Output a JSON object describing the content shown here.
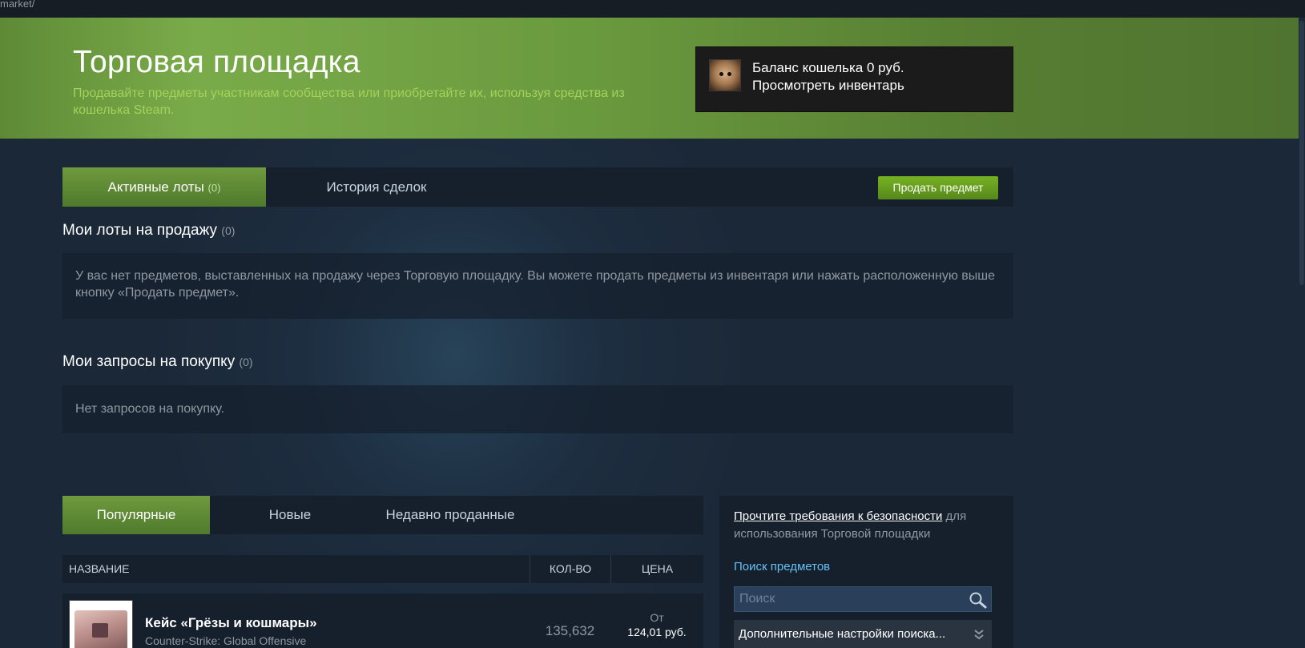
{
  "browser": {
    "url_fragment": "market/"
  },
  "hero": {
    "title": "Торговая площадка",
    "subtitle": "Продавайте предметы участникам сообщества или приобретайте их, используя средства из кошелька Steam."
  },
  "wallet": {
    "balance": "Баланс кошелька 0 руб.",
    "inventory_link": "Просмотреть инвентарь",
    "avatar_icon": "hamster-avatar"
  },
  "tabs": {
    "active_listings": "Активные лоты",
    "active_listings_count": "(0)",
    "history": "История сделок",
    "sell_button": "Продать предмет"
  },
  "my_listings": {
    "title": "Мои лоты на продажу",
    "count": "(0)",
    "empty_text": "У вас нет предметов, выставленных на продажу через Торговую площадку. Вы можете продать предметы из инвентаря или нажать расположенную выше кнопку «Продать предмет»."
  },
  "my_orders": {
    "title": "Мои запросы на покупку",
    "count": "(0)",
    "empty_text": "Нет запросов на покупку."
  },
  "browse_tabs": {
    "popular": "Популярные",
    "new": "Новые",
    "recently_sold": "Недавно проданные"
  },
  "table": {
    "headers": {
      "name": "НАЗВАНИЕ",
      "qty": "КОЛ-ВО",
      "price": "ЦЕНА"
    },
    "rows": [
      {
        "name": "Кейс «Грёзы и кошмары»",
        "game": "Counter-Strike: Global Offensive",
        "qty": "135,632",
        "price_from": "От",
        "price": "124,01 руб."
      }
    ]
  },
  "sidebar": {
    "security_link": "Прочтите требования к безопасности",
    "security_rest": " для использования Торговой площадки",
    "search_label": "Поиск предметов",
    "search_placeholder": "Поиск",
    "search_value": "",
    "advanced": "Дополнительные настройки поиска..."
  },
  "colors": {
    "accent_green": "#75b022",
    "background": "#1b2838",
    "link_blue": "#66c0f4"
  }
}
